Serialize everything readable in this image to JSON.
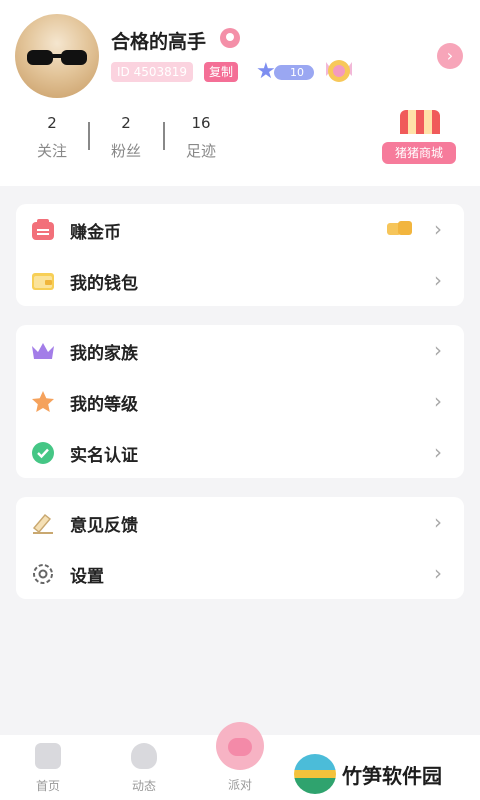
{
  "profile": {
    "username": "合格的高手",
    "id_label": "ID 4503819",
    "copy_label": "复制",
    "level": "10"
  },
  "stats": [
    {
      "count": "2",
      "label": "关注"
    },
    {
      "count": "2",
      "label": "粉丝"
    },
    {
      "count": "16",
      "label": "足迹"
    }
  ],
  "shop": {
    "label": "猪猪商城"
  },
  "menu_wallet": [
    {
      "label": "赚金币",
      "icon": "earn-coins-icon"
    },
    {
      "label": "我的钱包",
      "icon": "wallet-icon"
    }
  ],
  "menu_identity": [
    {
      "label": "我的家族",
      "icon": "crown-icon"
    },
    {
      "label": "我的等级",
      "icon": "star-icon"
    },
    {
      "label": "实名认证",
      "icon": "verified-check-icon"
    }
  ],
  "menu_misc": [
    {
      "label": "意见反馈",
      "icon": "feedback-icon"
    },
    {
      "label": "设置",
      "icon": "gear-icon"
    }
  ],
  "tabs": {
    "home": "首页",
    "feed": "动态",
    "party": "派对"
  },
  "watermark": {
    "text": "竹笋软件园"
  },
  "colors": {
    "accent_pink": "#f46f96",
    "background": "#f4f4f6",
    "card": "#ffffff"
  }
}
